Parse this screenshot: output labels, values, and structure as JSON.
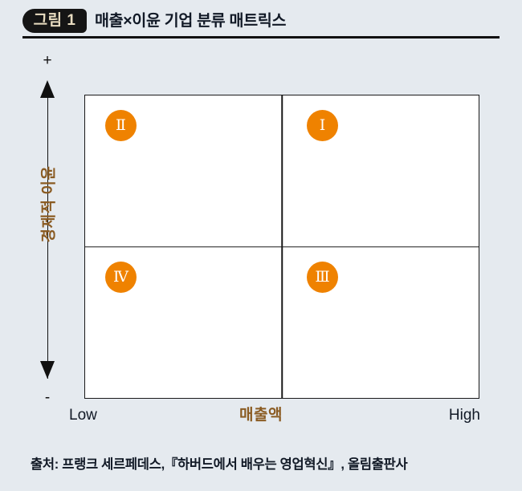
{
  "header": {
    "badge_label": "그림 1",
    "title": "매출×이윤 기업 분류 매트릭스"
  },
  "chart_data": {
    "type": "scatter",
    "title": "매출×이윤 기업 분류 매트릭스",
    "xlabel": "매출액",
    "ylabel": "경제적 이윤",
    "x_tick_labels": [
      "Low",
      "High"
    ],
    "y_tick_labels": [
      "+",
      "-"
    ],
    "grid": true,
    "legend": "none",
    "quadrants": [
      {
        "id": "II",
        "label": "Ⅱ",
        "position": "top-left",
        "x": "Low",
        "y": "+"
      },
      {
        "id": "I",
        "label": "Ⅰ",
        "position": "top-right",
        "x": "High",
        "y": "+"
      },
      {
        "id": "IV",
        "label": "Ⅳ",
        "position": "bottom-left",
        "x": "Low",
        "y": "-"
      },
      {
        "id": "III",
        "label": "Ⅲ",
        "position": "bottom-right",
        "x": "High",
        "y": "-"
      }
    ],
    "colors": {
      "bubble": "#ef8200",
      "bubble_text": "#ffffff",
      "axis_label": "#8a5b22",
      "tick_label": "#111926",
      "matrix_border": "#1a1a1a",
      "matrix_fill": "#ffffff",
      "background": "#e5eaef"
    }
  },
  "yaxis": {
    "top_sign": "+",
    "bottom_sign": "-",
    "label": "경제적 이윤"
  },
  "xaxis": {
    "low_label": "Low",
    "center_label": "매출액",
    "high_label": "High"
  },
  "quadrant_labels": {
    "top_left": "Ⅱ",
    "top_right": "Ⅰ",
    "bottom_left": "Ⅳ",
    "bottom_right": "Ⅲ"
  },
  "footer": {
    "source": "출처: 프랭크 세르페데스,『하버드에서 배우는 영업혁신』, 올림출판사"
  }
}
